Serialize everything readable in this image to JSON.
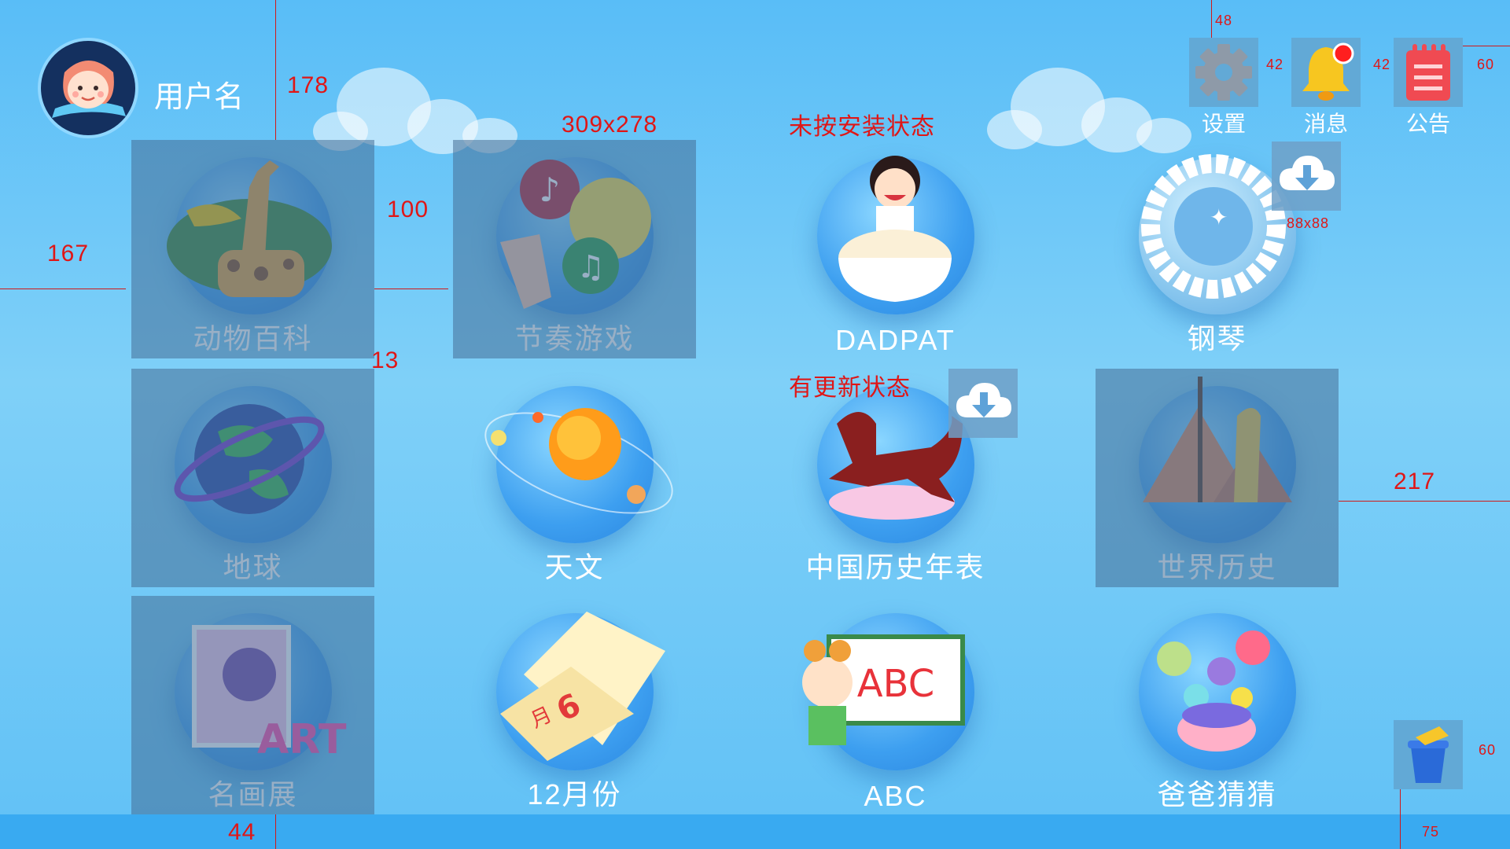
{
  "user": {
    "name": "用户名"
  },
  "top_actions": [
    {
      "id": "settings",
      "label": "设置",
      "icon": "gear-icon"
    },
    {
      "id": "messages",
      "label": "消息",
      "icon": "bell-icon",
      "badge": true
    },
    {
      "id": "notice",
      "label": "公告",
      "icon": "notice-icon"
    }
  ],
  "apps": [
    {
      "label": "动物百科",
      "icon": "giraffe-icon",
      "state": "dimmed"
    },
    {
      "label": "节奏游戏",
      "icon": "music-icon",
      "state": "dimmed"
    },
    {
      "label": "DADPAT",
      "icon": "drum-girl-icon",
      "state": "normal"
    },
    {
      "label": "钢琴",
      "icon": "piano-icon",
      "state": "not-installed"
    },
    {
      "label": "地球",
      "icon": "globe-icon",
      "state": "dimmed"
    },
    {
      "label": "天文",
      "icon": "solar-system-icon",
      "state": "normal"
    },
    {
      "label": "中国历史年表",
      "icon": "bronze-horse-icon",
      "state": "update"
    },
    {
      "label": "世界历史",
      "icon": "pyramid-icon",
      "state": "dimmed"
    },
    {
      "label": "名画展",
      "icon": "art-icon",
      "state": "dimmed"
    },
    {
      "label": "12月份",
      "icon": "calendar-icon",
      "state": "normal"
    },
    {
      "label": "ABC",
      "icon": "abc-board-icon",
      "state": "normal"
    },
    {
      "label": "爸爸猜猜",
      "icon": "balls-icon",
      "state": "normal"
    }
  ],
  "calendar_text": {
    "month": "月",
    "num": "6"
  },
  "annotations": {
    "avatar_gap": "178",
    "tile_size": "309x278",
    "not_installed": "未按安装状态",
    "left_margin": "167",
    "col_gap": "100",
    "row_gap": "13",
    "has_update": "有更新状态",
    "right_margin": "217",
    "bottom_margin": "44",
    "download_size": "88x88",
    "top_margin": "48",
    "icon_gap1": "42",
    "icon_gap2": "42",
    "right_top": "60",
    "bin_right": "60",
    "bin_bottom": "75"
  },
  "colors": {
    "background": "#6ccaf7",
    "dim_overlay": "#466e96",
    "annotation": "#e01616",
    "bottom_bar": "#39aaf1"
  }
}
